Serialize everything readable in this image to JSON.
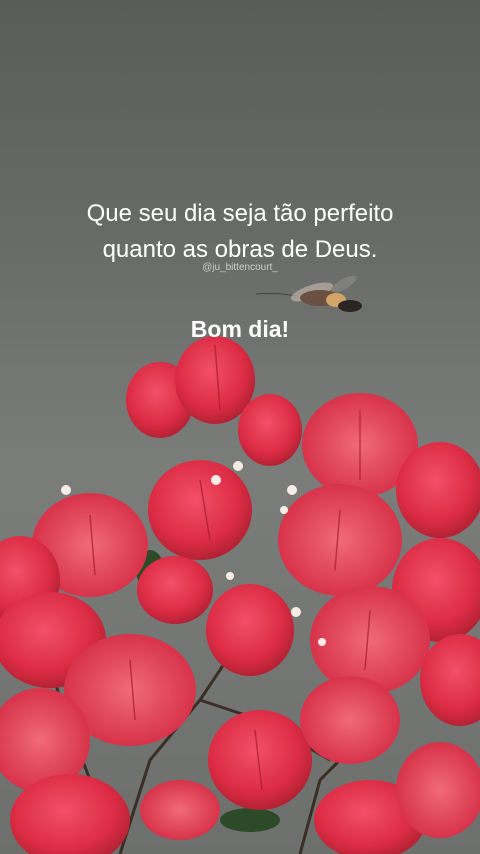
{
  "caption": {
    "line1": "Que seu dia seja tão perfeito",
    "line2": "quanto as obras de Deus."
  },
  "watermark": "@ju_bittencourt_",
  "greeting": "Bom dia!",
  "colors": {
    "flower": "#e0304a",
    "flower_dark": "#a81c2c",
    "flower_light": "#f04a5e",
    "leaf": "#2c4a28",
    "background": "#6a6c6a"
  },
  "icons": [
    "hummingbird-moth-icon",
    "bougainvillea-flowers-image"
  ]
}
